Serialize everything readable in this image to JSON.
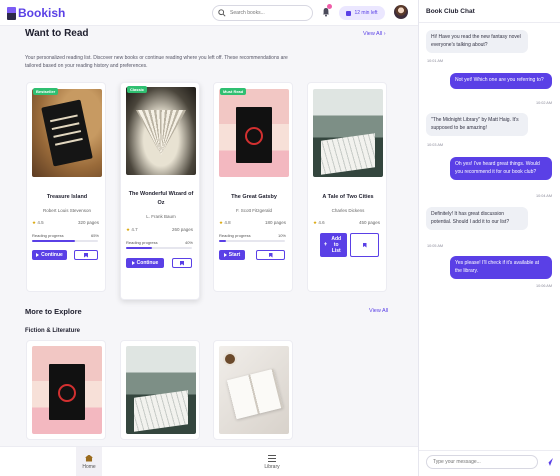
{
  "app": {
    "name": "Bookish"
  },
  "header": {
    "search_placeholder": "Search books...",
    "timer_label": "12 min left"
  },
  "want_to_read": {
    "title": "Want to Read",
    "view_all": "View All",
    "description": "Your personalized reading list. Discover new books or continue reading where you left off. These recommendations are tailored based on your reading history and preferences.",
    "books": [
      {
        "badge": "Bestseller",
        "title": "Treasure Island",
        "author": "Robert Louis Stevenson",
        "rating": "4.5",
        "pages": "320 pages",
        "progress_label": "Reading progress",
        "progress": 65,
        "progress_text": "65%",
        "action": "Continue",
        "cover": "treasure"
      },
      {
        "badge": "Classic",
        "title": "The Wonderful Wizard of Oz",
        "author": "L. Frank Baum",
        "rating": "4.7",
        "pages": "260 pages",
        "progress_label": "Reading progress",
        "progress": 40,
        "progress_text": "40%",
        "action": "Continue",
        "cover": "oz"
      },
      {
        "badge": "Must Read",
        "title": "The Great Gatsby",
        "author": "F. Scott Fitzgerald",
        "rating": "4.8",
        "pages": "180 pages",
        "progress_label": "Reading progress",
        "progress": 10,
        "progress_text": "10%",
        "action": "Start",
        "cover": "gatsby"
      },
      {
        "badge": "",
        "title": "A Tale of Two Cities",
        "author": "Charles Dickens",
        "rating": "4.6",
        "pages": "450 pages",
        "action": "Add to List",
        "cover": "tale"
      }
    ]
  },
  "more_to_explore": {
    "title": "More to Explore",
    "view_all": "View All",
    "subsection": "Fiction & Literature"
  },
  "bottom_nav": {
    "home": "Home",
    "library": "Library"
  },
  "chat": {
    "title": "Book Club Chat",
    "messages": [
      {
        "dir": "in",
        "text": "Hi! Have you read the new fantasy novel everyone's talking about?",
        "time": "10:01 AM"
      },
      {
        "dir": "out",
        "text": "Not yet! Which one are you referring to?",
        "time": "10:02 AM"
      },
      {
        "dir": "in",
        "text": "\"The Midnight Library\" by Matt Haig. It's supposed to be amazing!",
        "time": "10:03 AM"
      },
      {
        "dir": "out",
        "text": "Oh yes! I've heard great things. Would you recommend it for our book club?",
        "time": "10:04 AM"
      },
      {
        "dir": "in",
        "text": "Definitely! It has great discussion potential. Should I add it to our list?",
        "time": "10:05 AM"
      },
      {
        "dir": "out",
        "text": "Yes please! I'll check if it's available at the library.",
        "time": "10:06 AM"
      }
    ],
    "input_placeholder": "Type your message..."
  },
  "colors": {
    "accent": "#5a40e6",
    "badge_green": "#2fbf71",
    "star": "#d9a300",
    "notification": "#ef5da8"
  }
}
